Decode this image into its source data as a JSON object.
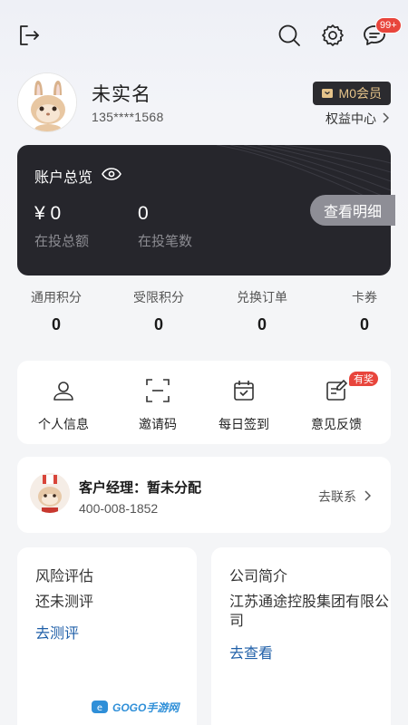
{
  "topbar": {
    "logout_icon": "logout-icon",
    "search_icon": "search-icon",
    "settings_icon": "gear-icon",
    "message_icon": "message-icon",
    "message_badge": "99+"
  },
  "profile": {
    "name": "未实名",
    "phone": "135****1568",
    "member_label": "M0会员",
    "rights_label": "权益中心"
  },
  "account": {
    "title": "账户总览",
    "amount": "¥ 0",
    "amount_label": "在投总额",
    "count": "0",
    "count_label": "在投笔数",
    "detail_button": "查看明细"
  },
  "stats": [
    {
      "label": "通用积分",
      "value": "0"
    },
    {
      "label": "受限积分",
      "value": "0"
    },
    {
      "label": "兑换订单",
      "value": "0"
    },
    {
      "label": "卡券",
      "value": "0"
    }
  ],
  "quick_actions": [
    {
      "label": "个人信息",
      "icon": "person-icon"
    },
    {
      "label": "邀请码",
      "icon": "scan-icon"
    },
    {
      "label": "每日签到",
      "icon": "calendar-check-icon"
    },
    {
      "label": "意见反馈",
      "icon": "feedback-icon"
    }
  ],
  "award_badge": "有奖",
  "manager": {
    "title": "客户经理：暂未分配",
    "phone": "400-008-1852",
    "link": "去联系"
  },
  "risk_card": {
    "title": "风险评估",
    "status": "还未测评",
    "link": "去测评"
  },
  "company_card": {
    "title": "公司简介",
    "name": "江苏通途控股集团有限公司",
    "link": "去查看"
  },
  "watermark": "GOGO手游网",
  "colors": {
    "accent_link": "#1f5fa8",
    "badge_red": "#e8453c",
    "dark_card": "#26262c",
    "member_gold": "#e6c48a"
  }
}
